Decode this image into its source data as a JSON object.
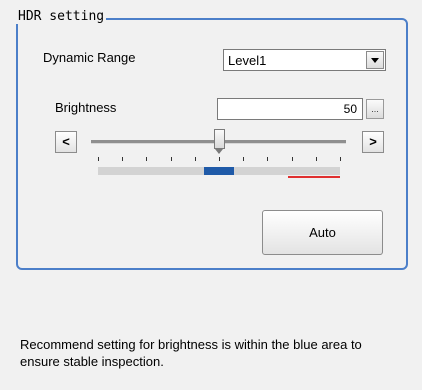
{
  "group": {
    "title": "HDR setting"
  },
  "dynamic_range": {
    "label": "Dynamic Range",
    "value": "Level1",
    "arrow_icon": "dropdown-arrow-icon"
  },
  "brightness": {
    "label": "Brightness",
    "value": "50",
    "more_label": "...",
    "decrement_label": "<",
    "increment_label": ">",
    "slider_fraction": 0.5,
    "recommended_band": [
      0.44,
      0.56
    ],
    "colors": {
      "recommended": "#1f5aa8",
      "warning": "#e03030",
      "accent": "#4c7fc9"
    }
  },
  "auto_button": {
    "label": "Auto"
  },
  "message": {
    "text": "Recommend setting for brightness is within the blue area to ensure stable inspection."
  }
}
